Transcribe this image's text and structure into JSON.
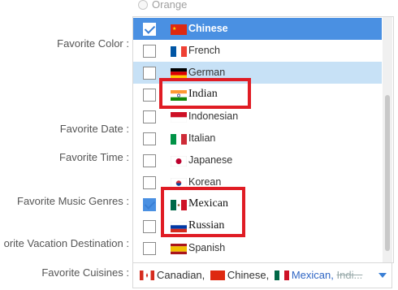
{
  "radio_remnant": {
    "label": "Orange"
  },
  "labels": {
    "favorite_color": "Favorite Color :",
    "favorite_date": "Favorite Date :",
    "favorite_time": "Favorite Time :",
    "favorite_music_genres": "Favorite Music Genres :",
    "favorite_vacation_destination": "orite Vacation Destination :",
    "favorite_cuisines": "Favorite Cuisines :"
  },
  "dropdown": {
    "items": [
      {
        "label": "Chinese",
        "checked": true,
        "flag_icon": "china-flag-icon"
      },
      {
        "label": "French",
        "checked": false,
        "flag_icon": "france-flag-icon"
      },
      {
        "label": "German",
        "checked": false,
        "flag_icon": "germany-flag-icon"
      },
      {
        "label": "Indian",
        "checked": false,
        "flag_icon": "india-flag-icon"
      },
      {
        "label": "Indonesian",
        "checked": false,
        "flag_icon": "indonesia-flag-icon"
      },
      {
        "label": "Italian",
        "checked": false,
        "flag_icon": "italy-flag-icon"
      },
      {
        "label": "Japanese",
        "checked": false,
        "flag_icon": "japan-flag-icon"
      },
      {
        "label": "Korean",
        "checked": false,
        "flag_icon": "korea-flag-icon"
      },
      {
        "label": "Mexican",
        "checked": true,
        "flag_icon": "mexico-flag-icon"
      },
      {
        "label": "Russian",
        "checked": false,
        "flag_icon": "russia-flag-icon"
      },
      {
        "label": "Spanish",
        "checked": false,
        "flag_icon": "spain-flag-icon"
      }
    ]
  },
  "cuisines_field": {
    "chip1": "Canadian,",
    "chip2": "Chinese,",
    "chip3": "Mexican,",
    "chip4": "Indi..."
  },
  "colors": {
    "active_row": "#4a90e2",
    "hover_row": "#c7e1f6",
    "highlight_box": "#e01c24",
    "link": "#2f66c4"
  }
}
